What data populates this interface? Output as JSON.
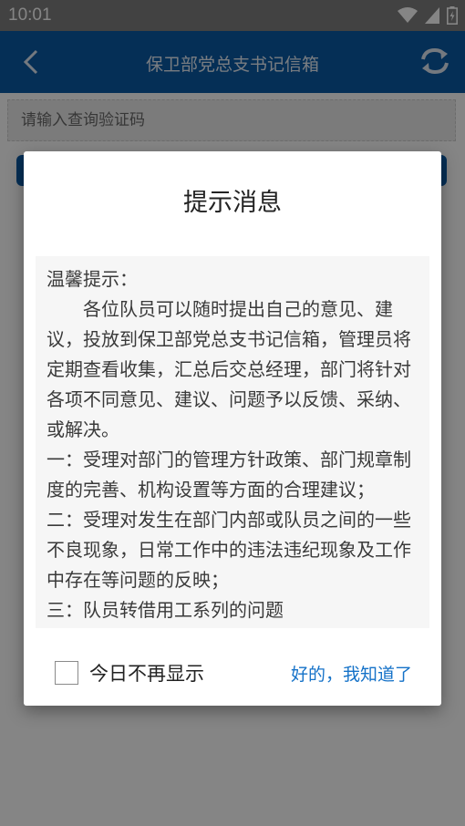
{
  "status_bar": {
    "time": "10:01"
  },
  "header": {
    "title": "保卫部党总支书记信箱"
  },
  "page": {
    "input_placeholder": "请输入查询验证码"
  },
  "dialog": {
    "title": "提示消息",
    "greeting": "温馨提示：",
    "paragraphs": [
      "各位队员可以随时提出自己的意见、建议，投放到保卫部党总支书记信箱，管理员将定期查看收集，汇总后交总经理，部门将针对各项不同意见、建议、问题予以反馈、采纳、或解决。"
    ],
    "items": [
      "一：受理对部门的管理方针政策、部门规章制度的完善、机构设置等方面的合理建议；",
      "二：受理对发生在部门内部或队员之间的一些不良现象，日常工作中的违法违纪现象及工作中存在等问题的反映；",
      "三：队员转借用工系列的问题"
    ],
    "checkbox_label": "今日不再显示",
    "confirm_label": "好的，我知道了"
  },
  "colors": {
    "primary": "#0b5aa6",
    "link": "#1572c8"
  },
  "icons": [
    "wifi-icon",
    "signal-icon",
    "battery-icon",
    "back-arrow-icon",
    "refresh-icon"
  ]
}
